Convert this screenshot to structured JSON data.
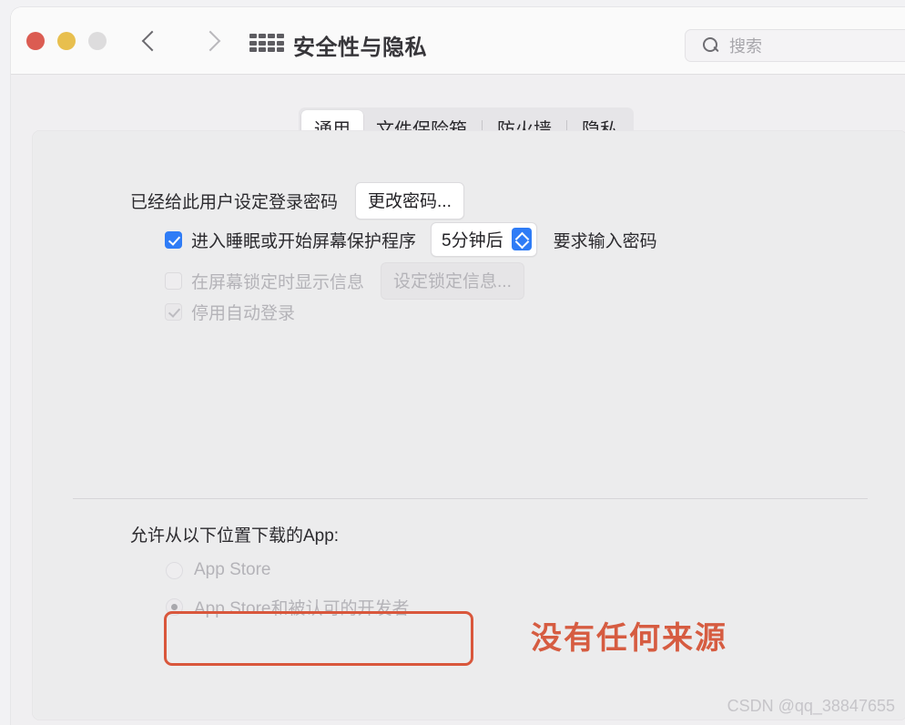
{
  "window": {
    "title": "安全性与隐私",
    "traffic_lights": [
      "close-red",
      "minimize-yellow",
      "zoom-gray"
    ],
    "nav": {
      "back": "back-chevron",
      "forward": "forward-chevron"
    },
    "show_all_icon": "grid-icon",
    "search": {
      "placeholder": "搜索",
      "value": "",
      "icon": "search-icon"
    }
  },
  "tabs": [
    {
      "label": "通用",
      "active": true
    },
    {
      "label": "文件保险箱",
      "active": false
    },
    {
      "label": "防火墙",
      "active": false
    },
    {
      "label": "隐私",
      "active": false
    }
  ],
  "general": {
    "password_status": "已经给此用户设定登录密码",
    "change_password_button": "更改密码...",
    "require_password": {
      "checked": true,
      "prefix_label": "进入睡眠或开始屏幕保护程序",
      "delay_value": "5分钟后",
      "suffix_label": "要求输入密码"
    },
    "show_message": {
      "checked": false,
      "enabled": false,
      "label": "在屏幕锁定时显示信息",
      "button": "设定锁定信息..."
    },
    "disable_auto_login": {
      "checked": true,
      "enabled": false,
      "label": "停用自动登录"
    }
  },
  "download_sources": {
    "heading": "允许从以下位置下载的App:",
    "enabled": false,
    "options": [
      {
        "label": "App Store",
        "selected": false
      },
      {
        "label": "App Store和被认可的开发者",
        "selected": true
      }
    ]
  },
  "annotation": {
    "highlight_box": "empty-region-highlight",
    "text": "没有任何来源",
    "color": "#d65c41"
  },
  "watermark": "CSDN @qq_38847655"
}
